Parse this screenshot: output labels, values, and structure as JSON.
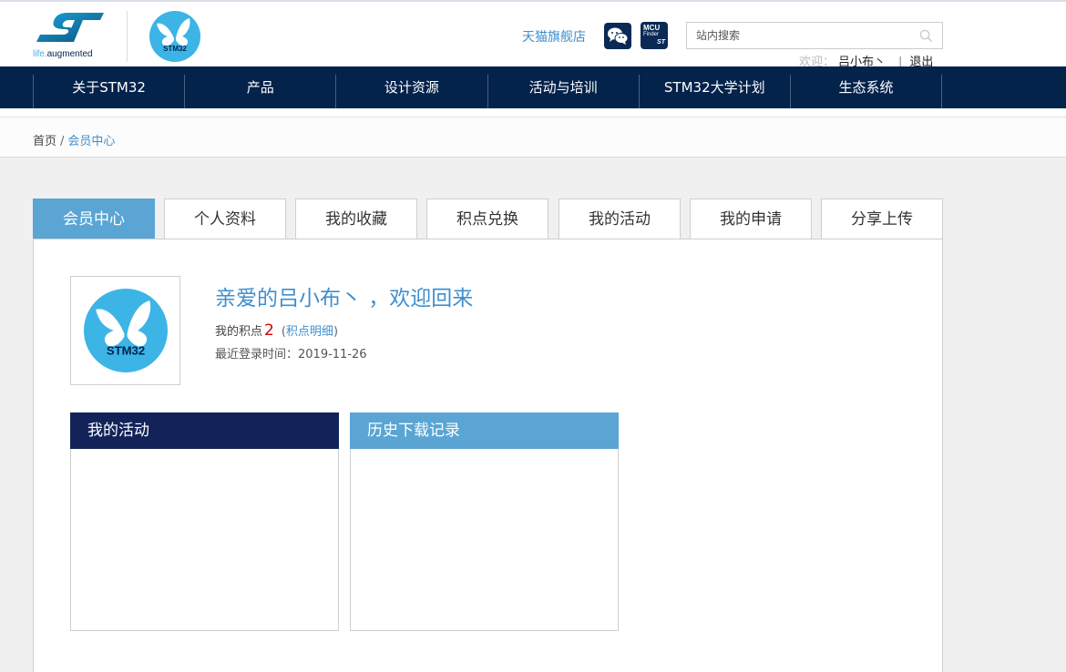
{
  "header": {
    "brand_tagline_life": "life.",
    "brand_tagline_rest": "augmented",
    "stm32_badge": "STM32",
    "tmall_link": "天猫旗舰店",
    "mcu_finder": {
      "title": "MCU",
      "subtitle": "Finder",
      "mark": "ST"
    },
    "search": {
      "placeholder": "站内搜索",
      "value": ""
    },
    "welcome_label": "欢迎：",
    "username": "吕小布丶",
    "separator": "|",
    "logout": "退出"
  },
  "nav": {
    "items": [
      {
        "label": "关于STM32"
      },
      {
        "label": "产品"
      },
      {
        "label": "设计资源"
      },
      {
        "label": "活动与培训"
      },
      {
        "label": "STM32大学计划"
      },
      {
        "label": "生态系统"
      }
    ]
  },
  "breadcrumb": {
    "home": "首页",
    "separator": "/",
    "current": "会员中心"
  },
  "tabs": [
    {
      "label": "会员中心",
      "active": true
    },
    {
      "label": "个人资料"
    },
    {
      "label": "我的收藏"
    },
    {
      "label": "积点兑换"
    },
    {
      "label": "我的活动"
    },
    {
      "label": "我的申请"
    },
    {
      "label": "分享上传"
    }
  ],
  "profile": {
    "avatar_badge": "STM32",
    "welcome_title": "亲爱的吕小布丶 ，欢迎回来",
    "points_label": "我的积点",
    "points_value": "2",
    "points_detail_open": "(",
    "points_detail_link": "积点明细",
    "points_detail_close": ")",
    "last_login": "最近登录时间：2019-11-26"
  },
  "boxes": {
    "activity_title": "我的活动",
    "download_title": "历史下载记录"
  },
  "colors": {
    "nav_bg": "#03234b",
    "accent": "#5aa5d4",
    "link": "#3f8fcf",
    "activity_head": "#13235a",
    "points": "#cc0000"
  }
}
